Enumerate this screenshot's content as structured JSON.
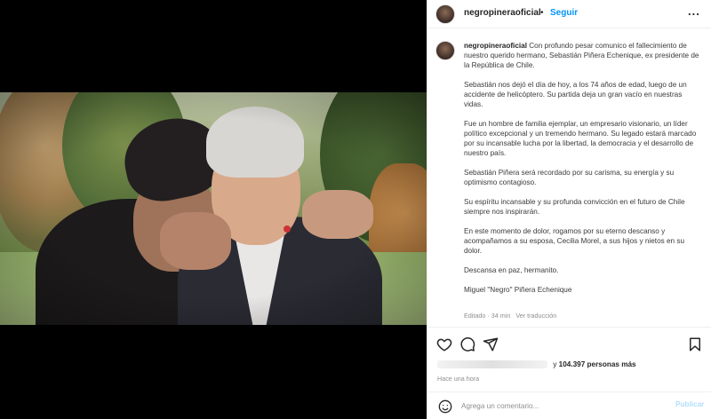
{
  "post": {
    "username": "negropineraoficial",
    "separator": "•",
    "follow_label": "Seguir",
    "more_label": "...",
    "caption": {
      "username": "negropineraoficial",
      "intro": "Con profundo pesar comunico el fallecimiento de nuestro querido hermano, Sebastián Piñera Echenique, ex presidente de la República de Chile.",
      "paragraphs": [
        "Sebastián nos dejó el día de hoy, a los 74 años de edad, luego de un accidente de helicóptero. Su partida deja un gran vacío en nuestras vidas.",
        "Fue un hombre de familia ejemplar, un empresario visionario, un líder político excepcional y un tremendo hermano. Su legado estará marcado por su incansable lucha por la libertad, la democracia y el desarrollo de nuestro país.",
        "Sebastián Piñera será recordado por su carisma, su energía y su optimismo contagioso.",
        "Su espíritu incansable y su profunda convicción en el futuro de Chile siempre nos inspirarán.",
        "En este momento de dolor, rogamos por su eterno descanso y acompañamos a su esposa, Cecilia Morel, a sus hijos y nietos en su dolor.",
        "Descansa en paz, hermanito."
      ],
      "signature": "Miguel \"Negro\" Piñera Echenique"
    },
    "meta": {
      "edited": "Editado · 34 min",
      "translate": "Ver traducción"
    },
    "likes": {
      "prefix": "y",
      "count": "104.397",
      "suffix": "personas más"
    },
    "time_ago": "Hace una hora",
    "comment": {
      "placeholder": "Agrega un comentario...",
      "post_label": "Publicar"
    }
  },
  "icons": {
    "heart": "heart-icon",
    "comment": "comment-icon",
    "share": "share-icon",
    "bookmark": "bookmark-icon",
    "emoji": "emoji-icon"
  },
  "colors": {
    "accent": "#0095f6",
    "post_disabled": "#b2dffc",
    "secondary_text": "#8e8e8e"
  }
}
